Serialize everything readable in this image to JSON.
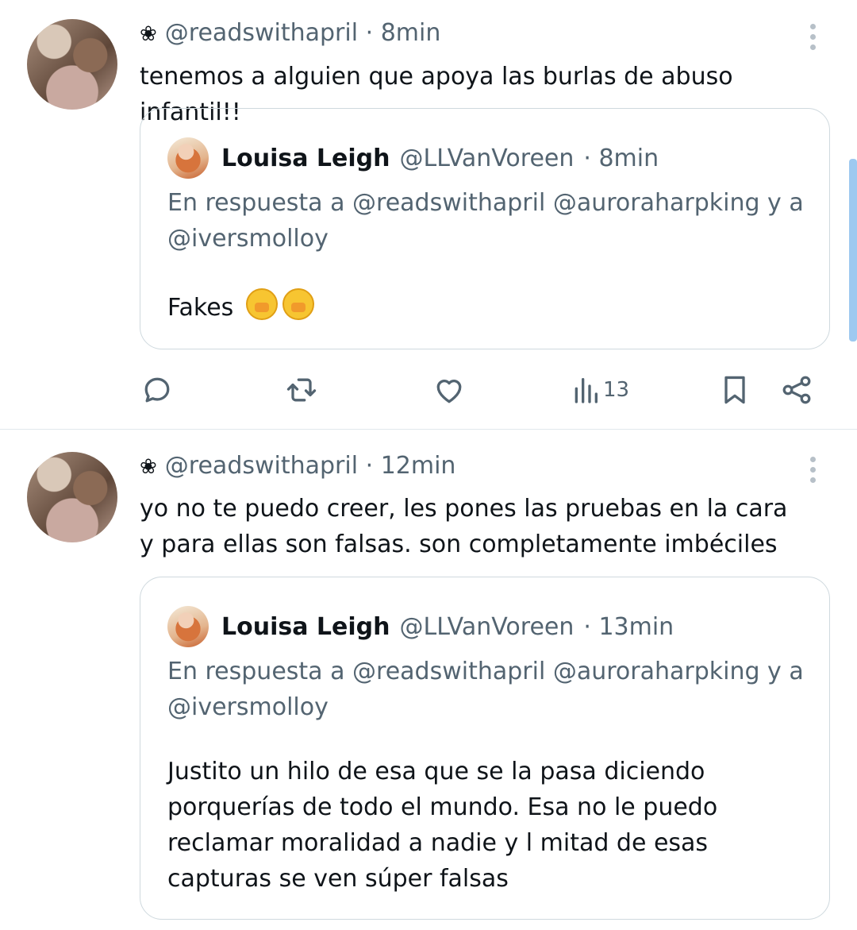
{
  "tweets": [
    {
      "author_icon": "flower-icon",
      "flower": "❀",
      "handle": "@readswithapril",
      "time": "· 8min",
      "text": "tenemos a alguien que apoya las burlas de abuso infantil!!",
      "quote": {
        "name": "Louisa Leigh",
        "handle": "@LLVanVoreen",
        "time": "· 8min",
        "reply_to": "En respuesta a @readswithapril @auroraharpking y a @iversmolloy",
        "body": "Fakes"
      },
      "actions": {
        "views": "13"
      }
    },
    {
      "author_icon": "flower-icon",
      "flower": "❀",
      "handle": "@readswithapril",
      "time": "· 12min",
      "text": "yo no te puedo creer, les pones las pruebas en la cara y para ellas son falsas. son completamente imbéciles",
      "quote": {
        "name": "Louisa Leigh",
        "handle": "@LLVanVoreen",
        "time": "· 13min",
        "reply_to": "En respuesta a @readswithapril @auroraharpking y a @iversmolloy",
        "body": "Justito un hilo de esa que se la pasa diciendo porquerías de todo el mundo. Esa no le puedo reclamar moralidad a nadie y l mitad de esas capturas se ven súper falsas"
      }
    }
  ],
  "colors": {
    "text": "#0f1419",
    "secondary": "#536471",
    "border": "#cfd9de",
    "scroll": "#9ec9f0"
  }
}
